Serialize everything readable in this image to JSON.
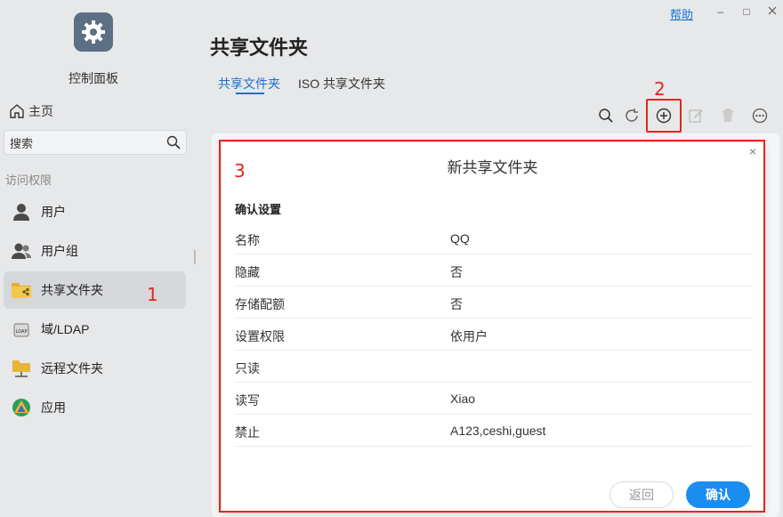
{
  "window": {
    "help": "帮助",
    "minimize": "–",
    "maximize": "□"
  },
  "sidebar": {
    "app_title": "控制面板",
    "home": "主页",
    "search_placeholder": "搜索",
    "section": "访问权限",
    "items": [
      {
        "label": "用户",
        "icon": "user-icon"
      },
      {
        "label": "用户组",
        "icon": "group-icon"
      },
      {
        "label": "共享文件夹",
        "icon": "shared-folder-icon",
        "active": true
      },
      {
        "label": "域/LDAP",
        "icon": "ldap-icon"
      },
      {
        "label": "远程文件夹",
        "icon": "remote-folder-icon"
      },
      {
        "label": "应用",
        "icon": "app-icon"
      }
    ]
  },
  "main": {
    "title": "共享文件夹",
    "tabs": [
      "共享文件夹",
      "ISO 共享文件夹"
    ]
  },
  "annotations": {
    "one": "1",
    "two": "2",
    "three": "3"
  },
  "dialog": {
    "title": "新共享文件夹",
    "close": "×",
    "section": "确认设置",
    "rows": [
      {
        "key": "名称",
        "value": "QQ"
      },
      {
        "key": "隐藏",
        "value": "否"
      },
      {
        "key": "存储配额",
        "value": "否"
      },
      {
        "key": "设置权限",
        "value": "依用户"
      },
      {
        "key": "只读",
        "value": ""
      },
      {
        "key": "读写",
        "value": "Xiao"
      },
      {
        "key": "禁止",
        "value": "A123,ceshi,guest"
      }
    ],
    "back": "返回",
    "confirm": "确认"
  },
  "colors": {
    "accent": "#1a8df0",
    "annotation": "#e8231c"
  }
}
